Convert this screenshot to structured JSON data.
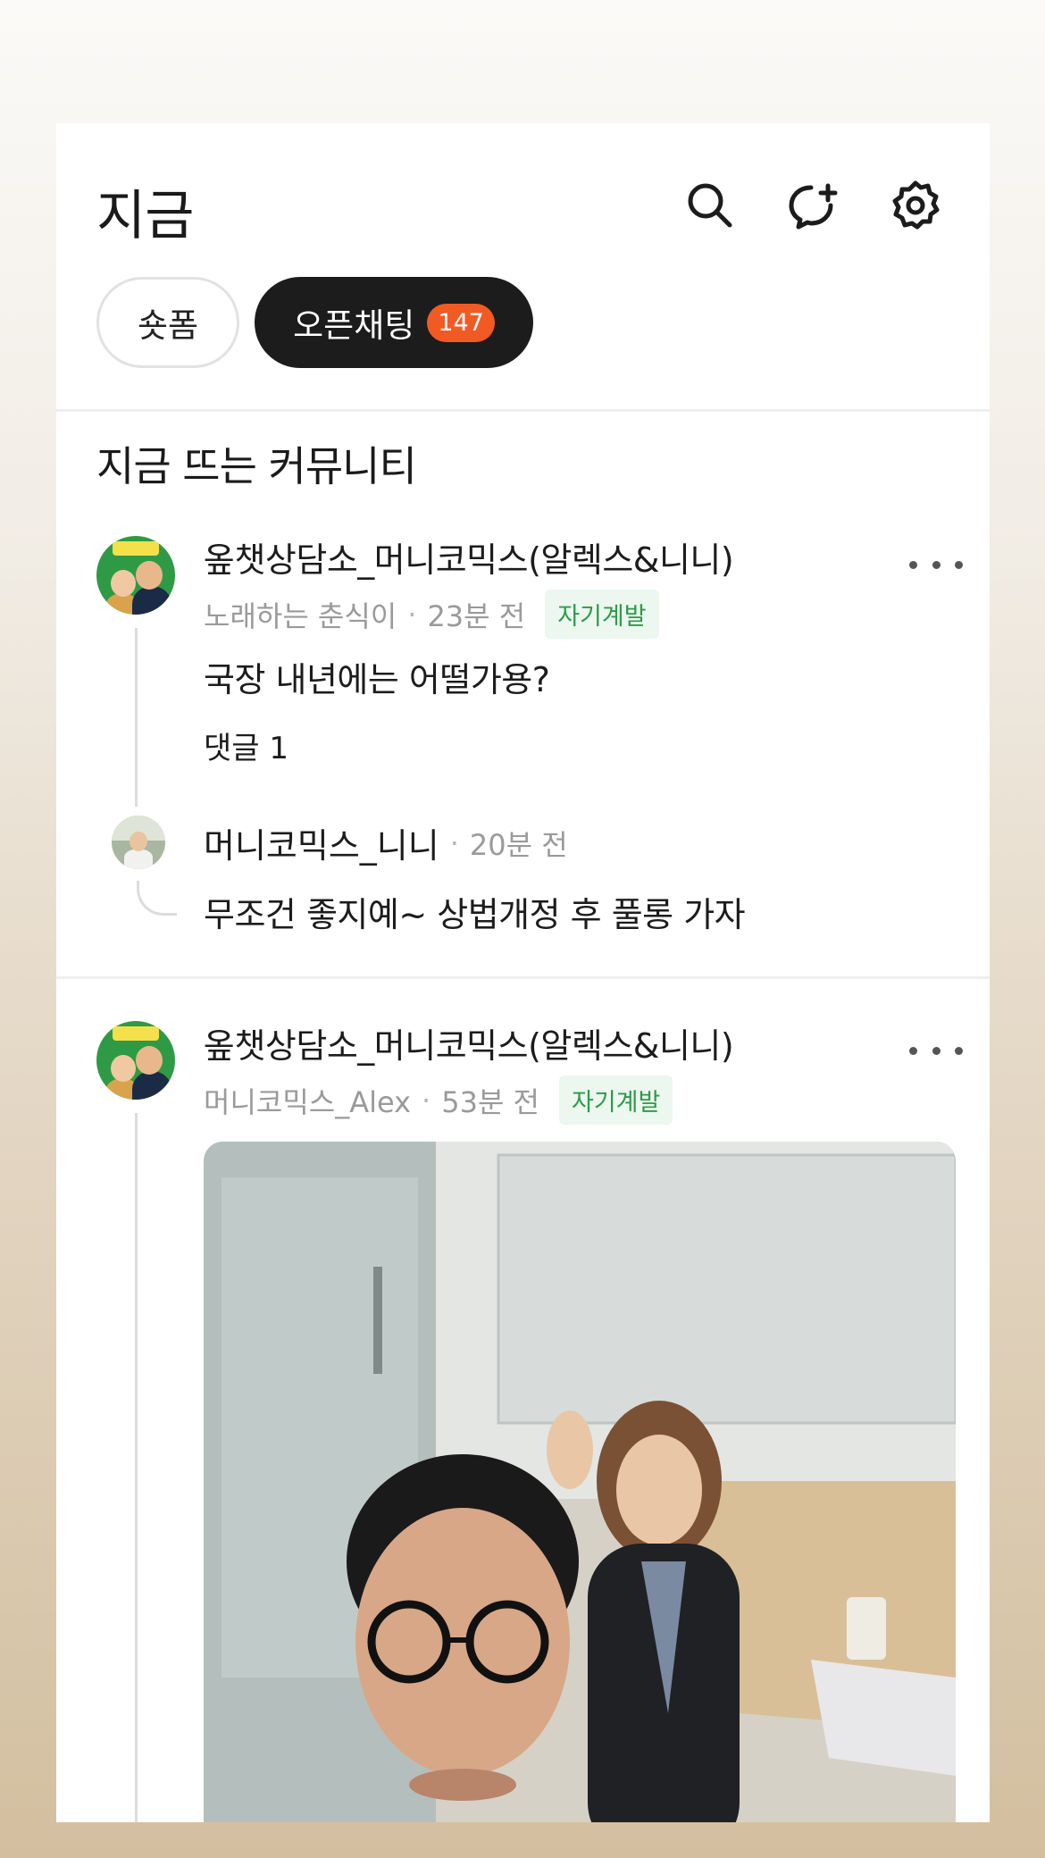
{
  "header": {
    "title": "지금",
    "icons": [
      "search-icon",
      "add-chat-icon",
      "settings-icon"
    ]
  },
  "tabs": [
    {
      "label": "숏폼"
    },
    {
      "label": "오픈채팅",
      "badge": "147"
    }
  ],
  "section": {
    "title": "지금 뜨는 커뮤니티"
  },
  "posts": [
    {
      "community": "옾챗상담소_머니코믹스(알렉스&니니)",
      "author": "노래하는 춘식이",
      "separator": "·",
      "time": "23분 전",
      "category": "자기계발",
      "text": "국장 내년에는 어떨가용?",
      "comments": "댓글 1",
      "reply": {
        "author": "머니코믹스_니니",
        "separator": "·",
        "time": "20분 전",
        "text": "무조건 좋지예~ 상법개정 후 풀롱 가자"
      }
    },
    {
      "community": "옾챗상담소_머니코믹스(알렉스&니니)",
      "author": "머니코믹스_Alex",
      "separator": "·",
      "time": "53분 전",
      "category": "자기계발"
    }
  ],
  "colors": {
    "badge": "#f25a24",
    "category_text": "#2e9a4a",
    "category_bg": "#ecf7ef",
    "active_pill": "#1c1c1c"
  }
}
